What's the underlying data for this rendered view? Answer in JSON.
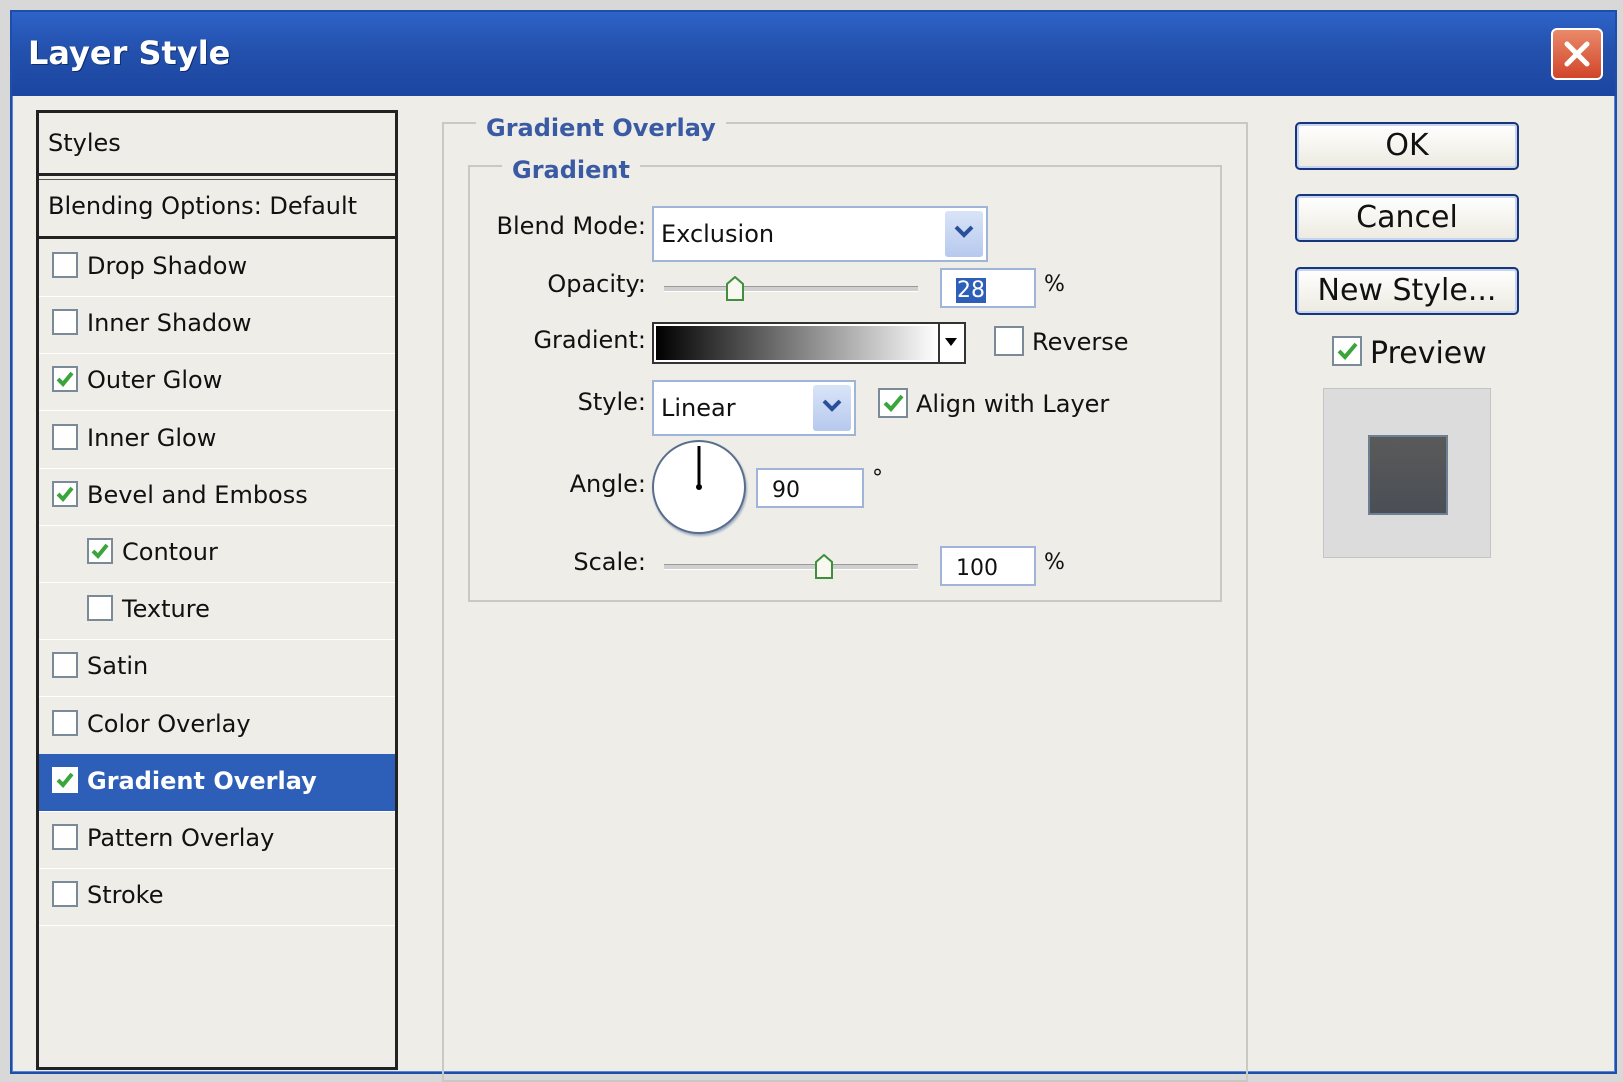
{
  "window": {
    "title": "Layer Style"
  },
  "styles_panel": {
    "header": "Styles",
    "blending_options": "Blending Options: Default",
    "items": [
      {
        "label": "Drop Shadow",
        "checked": false,
        "indent": false,
        "selected": false
      },
      {
        "label": "Inner Shadow",
        "checked": false,
        "indent": false,
        "selected": false
      },
      {
        "label": "Outer Glow",
        "checked": true,
        "indent": false,
        "selected": false
      },
      {
        "label": "Inner Glow",
        "checked": false,
        "indent": false,
        "selected": false
      },
      {
        "label": "Bevel and Emboss",
        "checked": true,
        "indent": false,
        "selected": false
      },
      {
        "label": "Contour",
        "checked": true,
        "indent": true,
        "selected": false
      },
      {
        "label": "Texture",
        "checked": false,
        "indent": true,
        "selected": false
      },
      {
        "label": "Satin",
        "checked": false,
        "indent": false,
        "selected": false
      },
      {
        "label": "Color Overlay",
        "checked": false,
        "indent": false,
        "selected": false
      },
      {
        "label": "Gradient Overlay",
        "checked": true,
        "indent": false,
        "selected": true
      },
      {
        "label": "Pattern Overlay",
        "checked": false,
        "indent": false,
        "selected": false
      },
      {
        "label": "Stroke",
        "checked": false,
        "indent": false,
        "selected": false
      }
    ]
  },
  "gradient_overlay": {
    "group_title": "Gradient Overlay",
    "subgroup_title": "Gradient",
    "blend_mode_label": "Blend Mode:",
    "blend_mode_value": "Exclusion",
    "opacity_label": "Opacity:",
    "opacity_value": "28",
    "opacity_unit": "%",
    "gradient_label": "Gradient:",
    "gradient_colors": [
      "#000000",
      "#ffffff"
    ],
    "reverse_label": "Reverse",
    "reverse_checked": false,
    "style_label": "Style:",
    "style_value": "Linear",
    "align_label": "Align with Layer",
    "align_checked": true,
    "angle_label": "Angle:",
    "angle_value": "90",
    "angle_unit": "°",
    "scale_label": "Scale:",
    "scale_value": "100",
    "scale_unit": "%",
    "opacity_slider_fraction": 0.28,
    "scale_slider_fraction": 0.63
  },
  "buttons": {
    "ok": "OK",
    "cancel": "Cancel",
    "new_style": "New Style...",
    "preview_label": "Preview",
    "preview_checked": true
  },
  "colors": {
    "titlebar": "#2351ad",
    "selection": "#2e5fb8",
    "legend_text": "#3b5aa4",
    "check": "#3aa53a"
  }
}
